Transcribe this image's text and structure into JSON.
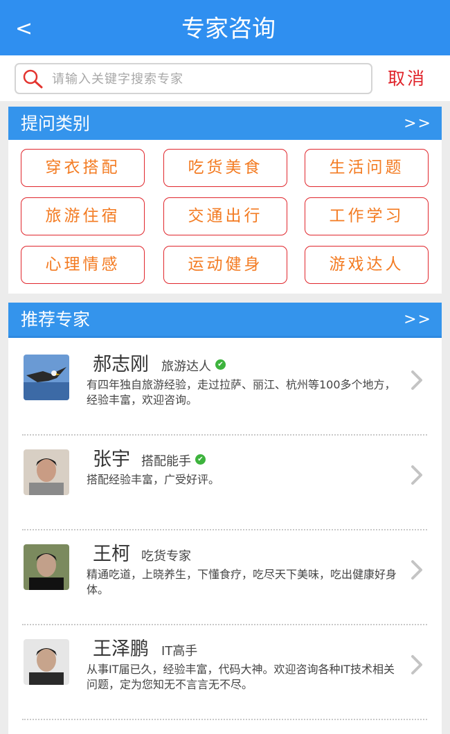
{
  "header": {
    "back_label": "<",
    "title": "专家咨询"
  },
  "search": {
    "placeholder": "请输入关键字搜索专家",
    "cancel_label": "取消"
  },
  "categories": {
    "title": "提问类别",
    "more": ">>",
    "items": [
      "穿衣搭配",
      "吃货美食",
      "生活问题",
      "旅游住宿",
      "交通出行",
      "工作学习",
      "心理情感",
      "运动健身",
      "游戏达人"
    ]
  },
  "experts": {
    "title": "推荐专家",
    "more": ">>",
    "items": [
      {
        "name": "郝志刚",
        "tag": "旅游达人",
        "verified": true,
        "avatar": "eagle-avatar",
        "desc": "有四年独自旅游经验，走过拉萨、丽江、杭州等100多个地方，经验丰富，欢迎咨询。"
      },
      {
        "name": "张宇",
        "tag": "搭配能手",
        "verified": true,
        "avatar": "man-avatar",
        "desc": "搭配经验丰富，广受好评。"
      },
      {
        "name": "王柯",
        "tag": "吃货专家",
        "verified": false,
        "avatar": "man-avatar",
        "desc": "精通吃道，上晓养生，下懂食疗，吃尽天下美味，吃出健康好身体。"
      },
      {
        "name": "王泽鹏",
        "tag": "IT高手",
        "verified": false,
        "avatar": "man-avatar",
        "desc": "从事IT届已久，经验丰富，代码大神。欢迎咨询各种IT技术相关问题，定为您知无不言言无不尽。"
      }
    ]
  },
  "colors": {
    "primary": "#2f8ff0",
    "cancel": "#e0242b",
    "category_border": "#e0262c",
    "category_text": "#f37b22",
    "verified": "#3db33d"
  }
}
